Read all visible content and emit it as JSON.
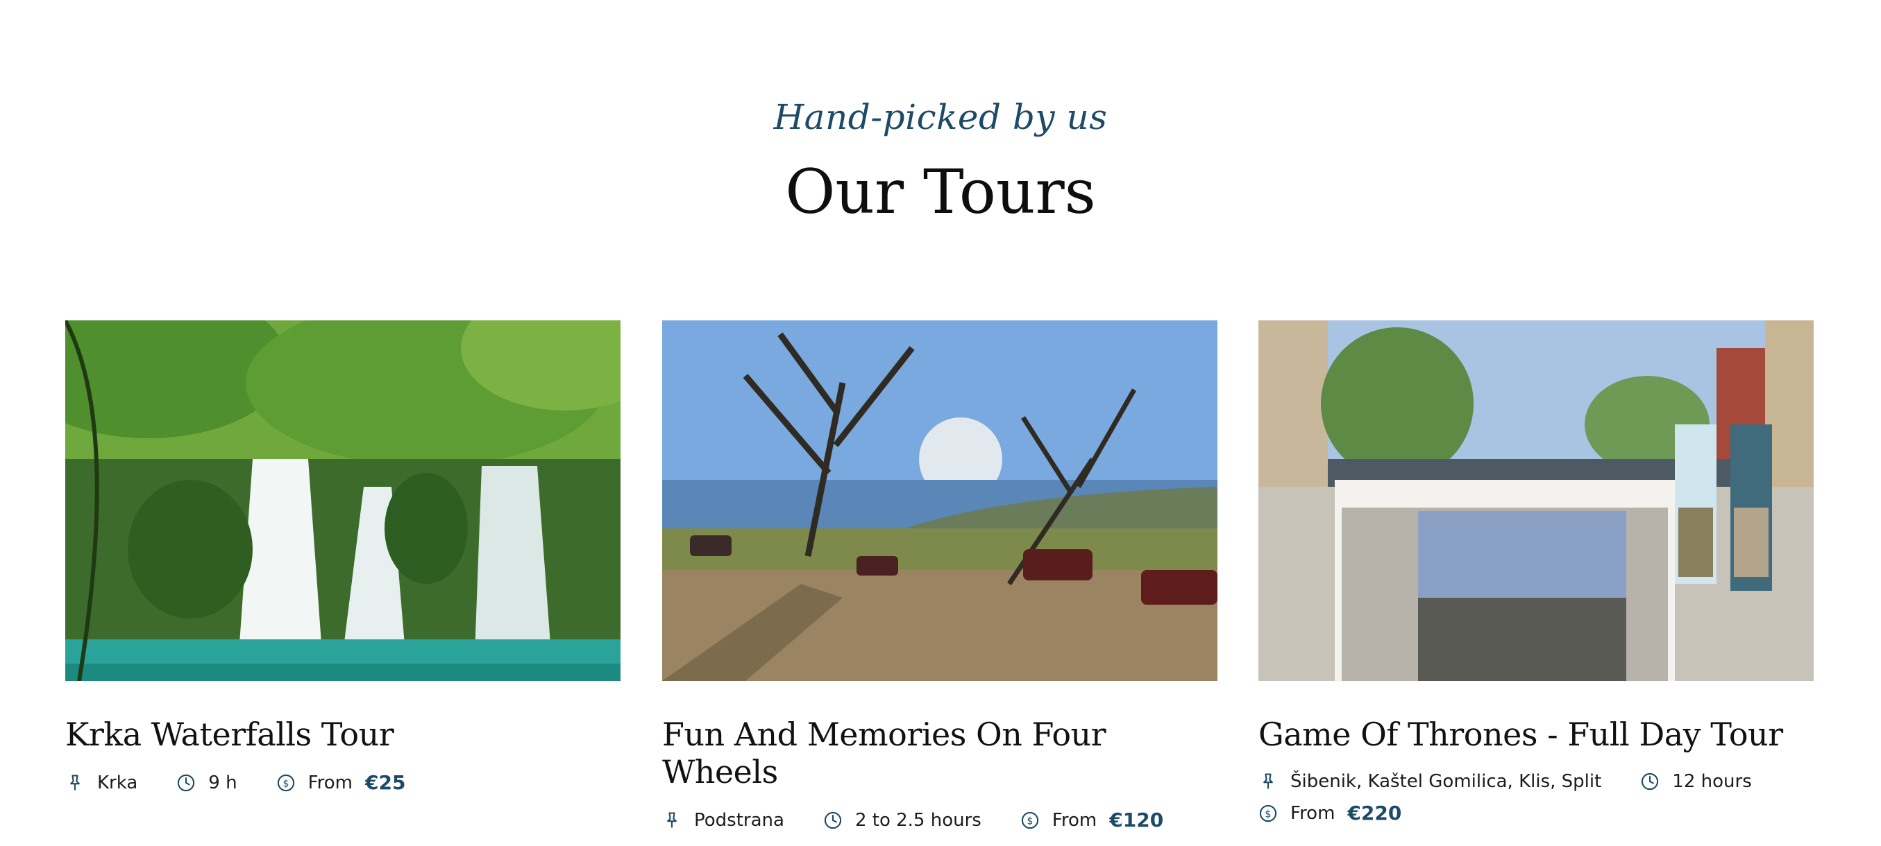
{
  "header": {
    "eyebrow": "Hand-picked by us",
    "title": "Our Tours"
  },
  "colors": {
    "accent": "#1d4a66",
    "text": "#111111"
  },
  "tours": [
    {
      "title": "Krka Waterfalls Tour",
      "location": "Krka",
      "duration": "9 h",
      "price_prefix": "From",
      "price": "€25",
      "image": "waterfall-photo",
      "icons": [
        "pin-icon",
        "clock-icon",
        "dollar-circle-icon"
      ]
    },
    {
      "title": "Fun And Memories On Four Wheels",
      "location": "Podstrana",
      "duration": "2 to 2.5 hours",
      "price_prefix": "From",
      "price": "€120",
      "image": "quad-bikes-hilltop-photo",
      "icons": [
        "pin-icon",
        "clock-icon",
        "dollar-circle-icon"
      ]
    },
    {
      "title": "Game Of Thrones - Full Day Tour",
      "location": "Šibenik, Kaštel Gomilica, Klis, Split",
      "duration": "12 hours",
      "price_prefix": "From",
      "price": "€220",
      "image": "game-of-thrones-location-photo",
      "icons": [
        "pin-icon",
        "clock-icon",
        "dollar-circle-icon"
      ]
    }
  ]
}
